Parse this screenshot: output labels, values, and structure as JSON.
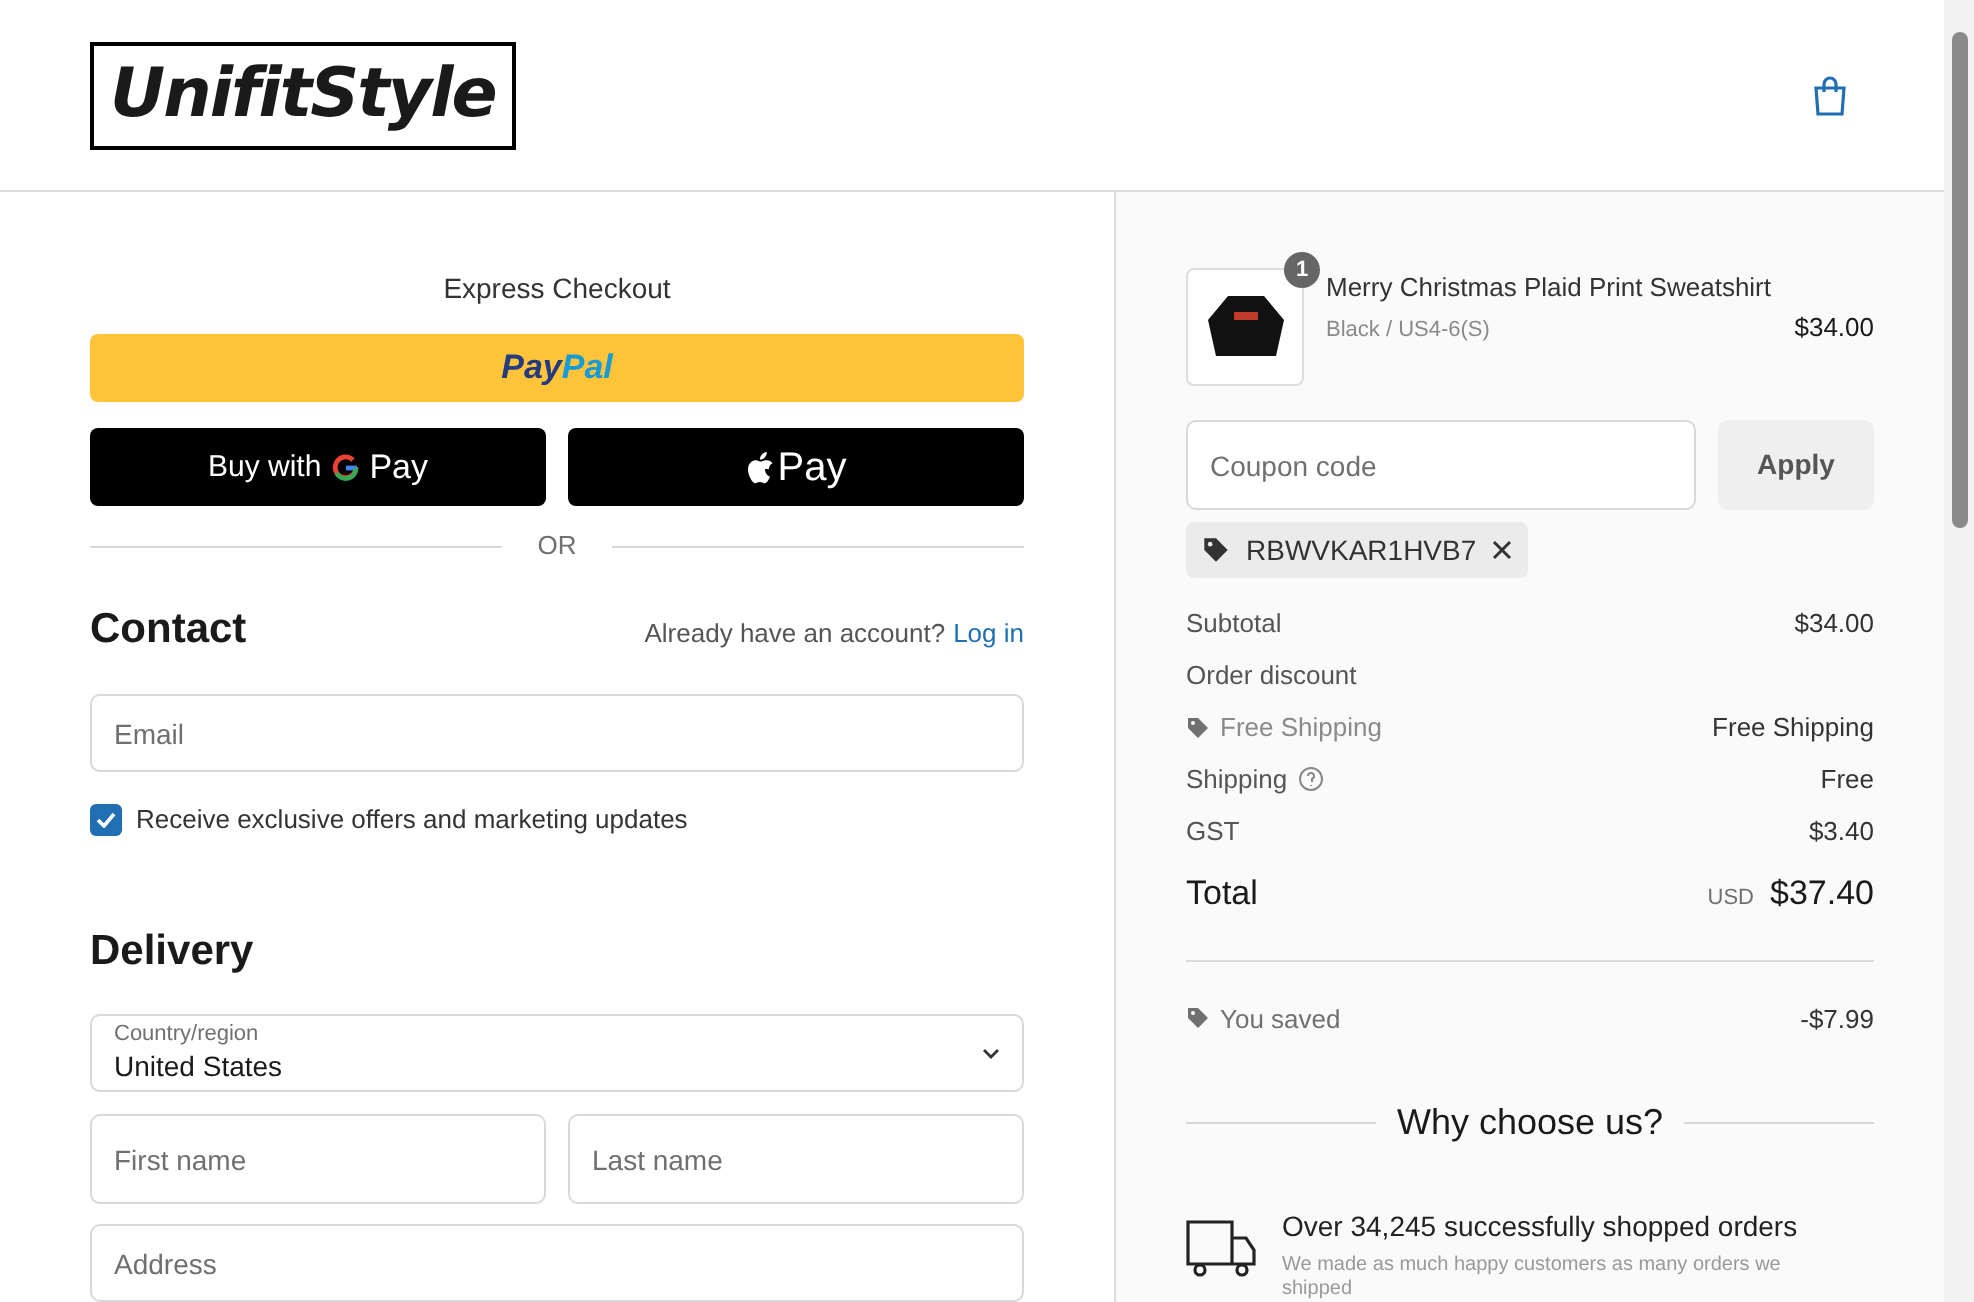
{
  "header": {
    "logo": "UnifitStyle"
  },
  "express": {
    "title": "Express Checkout",
    "paypal": [
      "Pay",
      "Pal"
    ],
    "gpay": {
      "prefix": "Buy with",
      "label": "Pay"
    },
    "applepay": {
      "label": "Pay"
    },
    "divider": "OR"
  },
  "contact": {
    "title": "Contact",
    "account_prompt": "Already have an account?",
    "login": "Log in",
    "email": {
      "placeholder": "Email"
    },
    "marketing": {
      "label": "Receive exclusive offers and marketing updates",
      "checked": true
    }
  },
  "delivery": {
    "title": "Delivery",
    "country": {
      "label": "Country/region",
      "value": "United States"
    },
    "first_name": {
      "placeholder": "First name"
    },
    "last_name": {
      "placeholder": "Last name"
    },
    "address": {
      "placeholder": "Address"
    }
  },
  "order": {
    "item": {
      "name": "Merry Christmas Plaid Print Sweatshirt",
      "variant": "Black / US4-6(S)",
      "price": "$34.00",
      "quantity": "1"
    },
    "coupon": {
      "placeholder": "Coupon code",
      "button": "Apply",
      "applied": "RBWVKAR1HVB7"
    },
    "lines": [
      {
        "kind": "plain",
        "label": "Subtotal",
        "value": "$34.00"
      },
      {
        "kind": "plain",
        "label": "Order discount"
      },
      {
        "kind": "discount",
        "label": "Free Shipping",
        "value": "Free Shipping"
      },
      {
        "kind": "help",
        "label": "Shipping",
        "value": "Free"
      },
      {
        "kind": "plain",
        "label": "GST",
        "value": "$3.40"
      }
    ],
    "total": {
      "label": "Total",
      "currency": "USD",
      "value": "$37.40"
    },
    "saved": {
      "label": "You saved",
      "value": "-$7.99"
    }
  },
  "why": {
    "title": "Why choose us?",
    "features": [
      {
        "title": "Over 34,245 successfully shopped orders",
        "text": "We made as much happy customers as many orders we shipped"
      }
    ]
  }
}
